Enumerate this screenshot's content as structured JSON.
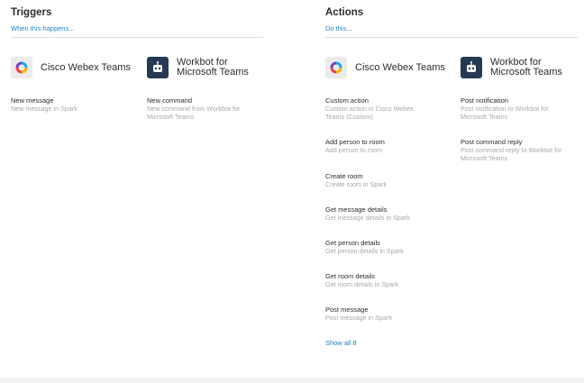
{
  "triggers": {
    "title": "Triggers",
    "subtitle": "When this happens...",
    "apps": [
      {
        "name": "Cisco Webex Teams",
        "icon": "webex-teams-icon"
      },
      {
        "name_line1": "Workbot for",
        "name_line2": "Microsoft Teams",
        "icon": "workbot-icon"
      }
    ],
    "items": [
      {
        "title": "New message",
        "desc": "New message in Spark"
      },
      {
        "title": "New command",
        "desc": "New command from Workbot for Microsoft Teams"
      }
    ]
  },
  "actions": {
    "title": "Actions",
    "subtitle": "Do this...",
    "apps": [
      {
        "name": "Cisco Webex Teams",
        "icon": "webex-teams-icon"
      },
      {
        "name_line1": "Workbot for",
        "name_line2": "Microsoft Teams",
        "icon": "workbot-icon"
      }
    ],
    "webex_items": [
      {
        "title": "Custom action",
        "desc": "Custom action in Cisco Webex Teams (Custom)"
      },
      {
        "title": "Add person to room",
        "desc": "Add person to room"
      },
      {
        "title": "Create room",
        "desc": "Create room in Spark"
      },
      {
        "title": "Get message details",
        "desc": "Get message details in Spark"
      },
      {
        "title": "Get person details",
        "desc": "Get person details in Spark"
      },
      {
        "title": "Get room details",
        "desc": "Get room details in Spark"
      },
      {
        "title": "Post message",
        "desc": "Post message in Spark"
      }
    ],
    "workbot_items": [
      {
        "title": "Post notification",
        "desc": "Post notification to Workbot for Microsoft Teams"
      },
      {
        "title": "Post command reply",
        "desc": "Post command reply to Workbot for Microsoft Teams"
      }
    ],
    "show_all_label": "Show all 8"
  },
  "colors": {
    "link": "#1e88c9",
    "workbot_bg": "#253a52",
    "muted_text": "#a9a9a9"
  }
}
